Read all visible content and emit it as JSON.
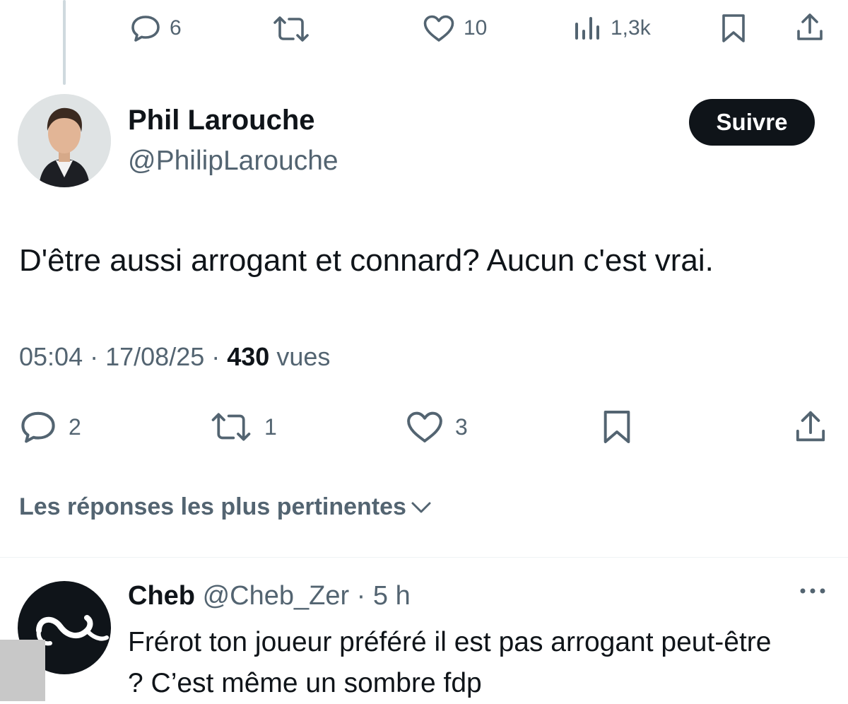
{
  "top_actions": {
    "replies": "6",
    "likes": "10",
    "views": "1,3k"
  },
  "tweet": {
    "author_name": "Phil Larouche",
    "author_handle": "@PhilipLarouche",
    "follow_label": "Suivre",
    "text": "D'être aussi arrogant et connard? Aucun c'est vrai.",
    "time": "05:04",
    "date": "17/08/25",
    "views_count": "430",
    "views_label": "vues",
    "actions": {
      "replies": "2",
      "reposts": "1",
      "likes": "3"
    }
  },
  "replies_sort": {
    "label": "Les réponses les plus pertinentes"
  },
  "reply": {
    "name": "Cheb",
    "handle": "@Cheb_Zer",
    "time": "5 h",
    "text": "Frérot ton joueur préféré il est pas arrogant peut-être ? C’est même un sombre fdp"
  },
  "colors": {
    "text_primary": "#0f1419",
    "text_secondary": "#536471",
    "thread_line": "#cfd9de",
    "button_bg": "#0f1419"
  }
}
